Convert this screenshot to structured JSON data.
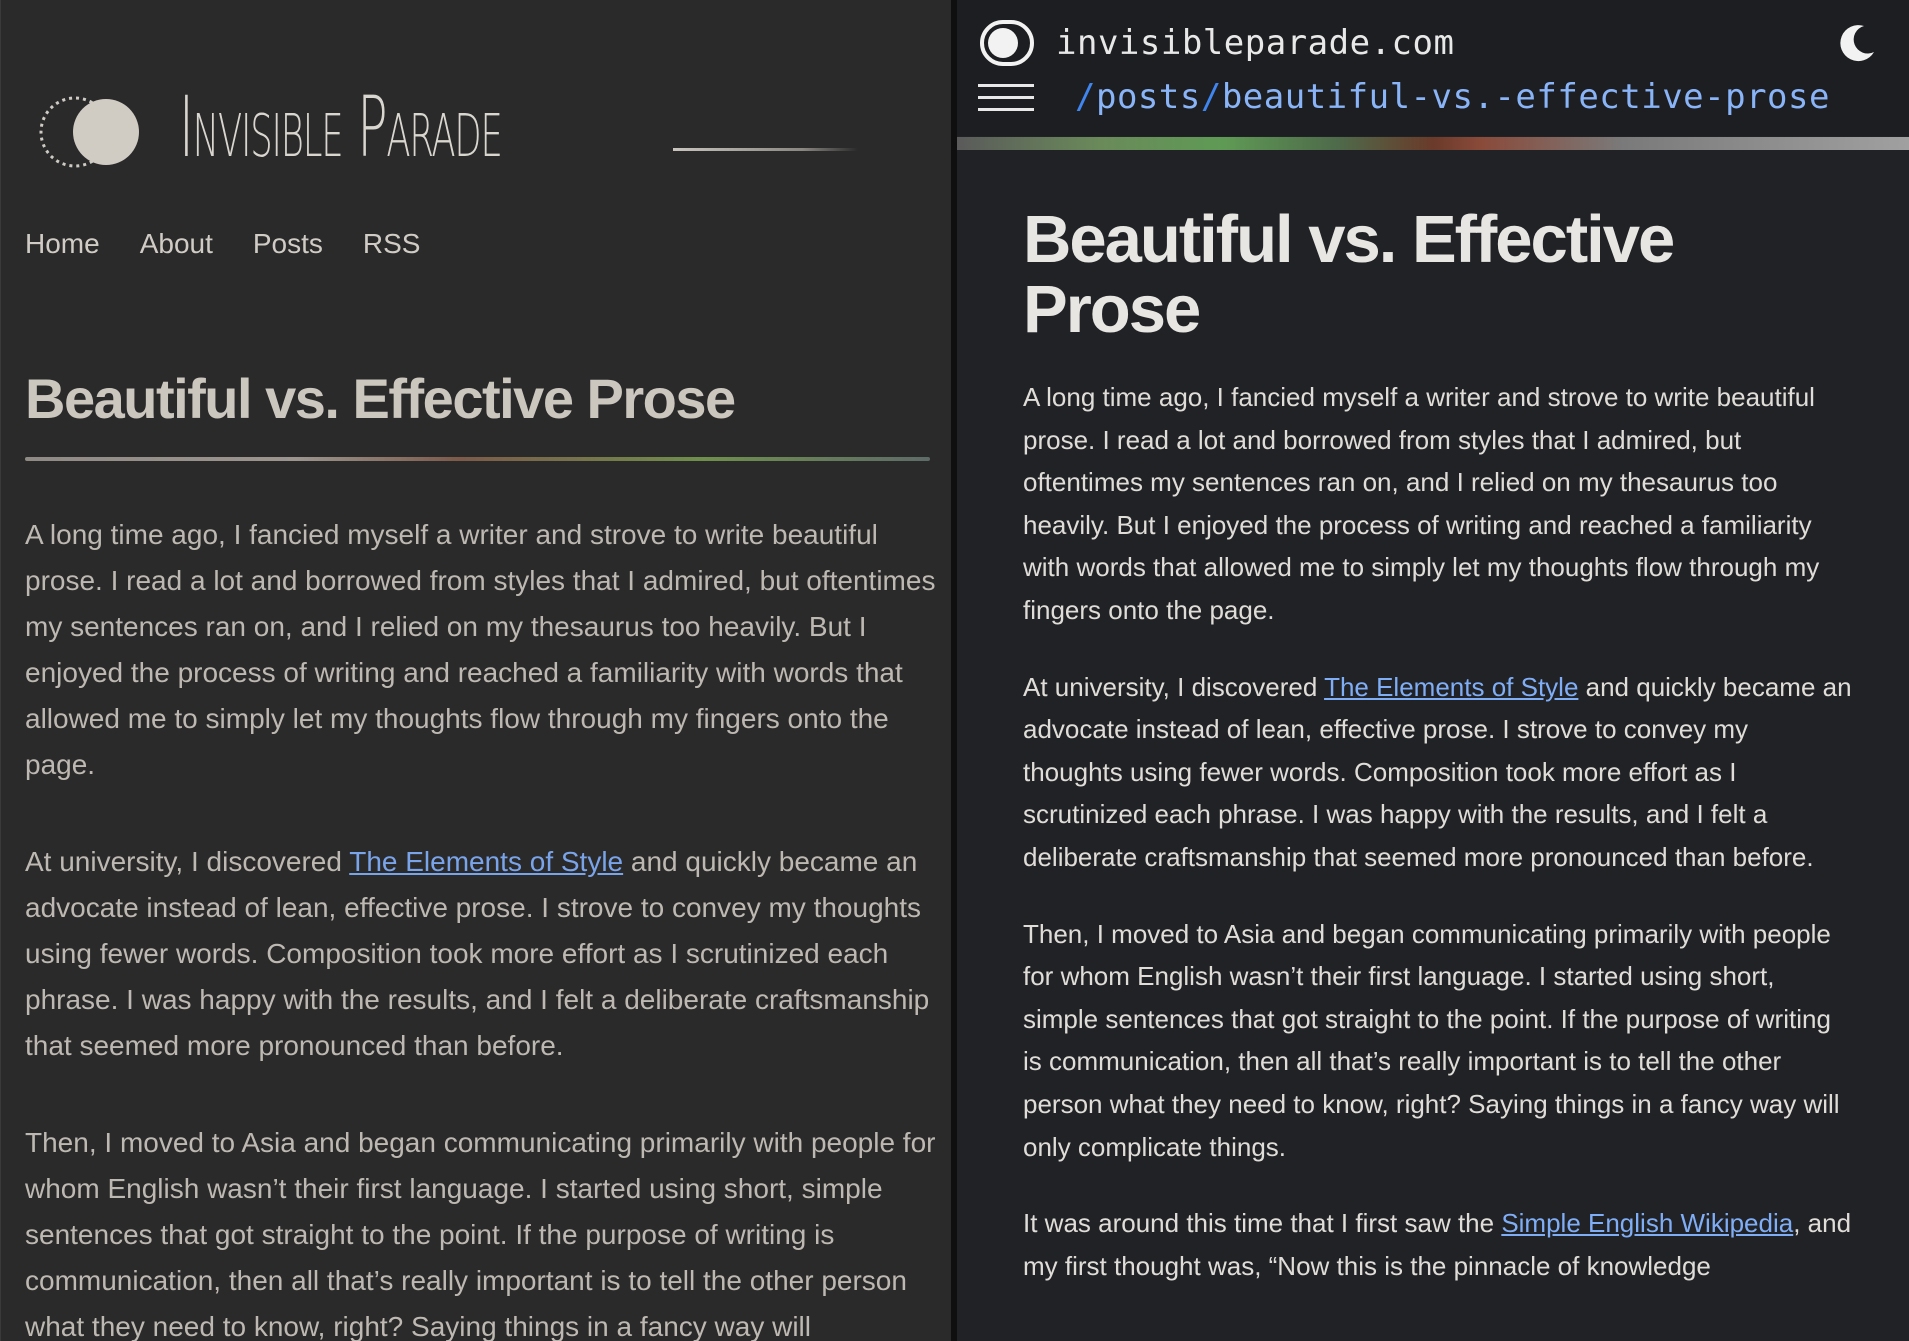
{
  "left": {
    "site_name": "Invisible Parade",
    "nav": [
      "Home",
      "About",
      "Posts",
      "RSS"
    ],
    "title": "Beautiful vs. Effective Prose",
    "p1": "A long time ago, I fancied myself a writer and strove to write beautiful prose. I read a lot and borrowed from styles that I admired, but oftentimes my sentences ran on, and I relied on my thesaurus too heavily. But I enjoyed the process of writing and reached a familiarity with words that allowed me to simply let my thoughts flow through my fingers onto the page.",
    "p2_before": "At university, I discovered ",
    "p2_link": "The Elements of Style",
    "p2_after": " and quickly became an advocate instead of lean, effective prose. I strove to convey my thoughts using fewer words. Composition took more effort as I scrutinized each phrase. I was happy with the results, and I felt a deliberate craftsmanship that seemed more pronounced than before.",
    "p3": "Then, I moved to Asia and began communicating primarily with people for whom English wasn’t their first language. I started using short, simple sentences that got straight to the point. If the purpose of writing is communication, then all that’s really important is to tell the other person what they need to know, right? Saying things in a fancy way will"
  },
  "right": {
    "domain": "invisibleparade.com",
    "path_slash1": "/",
    "path_seg1": "posts",
    "path_slash2": "/",
    "path_seg2": "beautiful-vs.-effective-prose",
    "title": "Beautiful vs. Effective Prose",
    "p1": "A long time ago, I fancied myself a writer and strove to write beautiful prose. I read a lot and borrowed from styles that I admired, but oftentimes my sentences ran on, and I relied on my thesaurus too heavily. But I enjoyed the process of writing and reached a familiarity with words that allowed me to simply let my thoughts flow through my fingers onto the page.",
    "p2_before": "At university, I discovered ",
    "p2_link": "The Elements of Style",
    "p2_after": " and quickly became an advocate instead of lean, effective prose. I strove to convey my thoughts using fewer words. Composition took more effort as I scrutinized each phrase. I was happy with the results, and I felt a deliberate craftsmanship that seemed more pronounced than before.",
    "p3": "Then, I moved to Asia and began communicating primarily with people for whom English wasn’t their first language. I started using short, simple sentences that got straight to the point. If the purpose of writing is communication, then all that’s really important is to tell the other person what they need to know, right? Saying things in a fancy way will only complicate things.",
    "p4_before": "It was around this time that I first saw the ",
    "p4_link": "Simple English Wikipedia",
    "p4_after": ", and my first thought was, “Now this is the pinnacle of knowledge"
  },
  "icons": {
    "left_logo": "logo-moon-icon",
    "right_toggle": "theme-toggle-icon",
    "right_moon": "moon-icon",
    "right_menu": "hamburger-menu-icon"
  },
  "colors": {
    "left_bg": "#2a2a2b",
    "right_bg": "#202226",
    "link": "#7aa4ea",
    "path_blue": "#3f86f0"
  }
}
